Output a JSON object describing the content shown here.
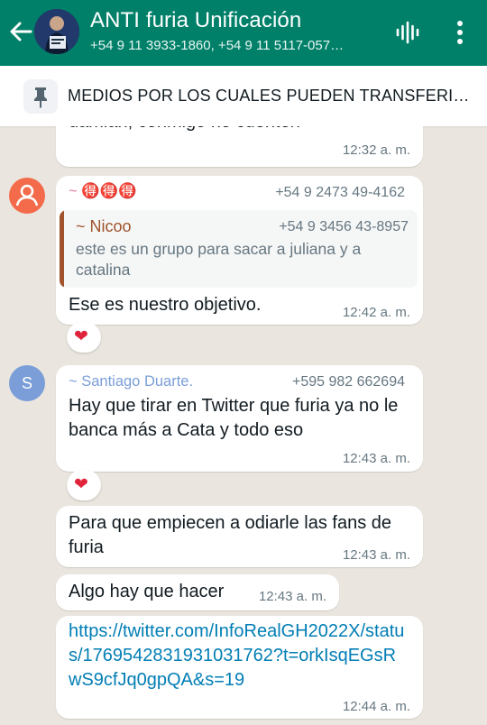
{
  "header": {
    "title": "ANTI furia Unificación",
    "subtitle": "+54 9 11 3933-1860, +54 9 11 5117-057…"
  },
  "pinned": {
    "text": "MEDIOS POR LOS CUALES PUEDEN TRANSFERIR…"
  },
  "messages": [
    {
      "text": "damián, conmigo no cuenten",
      "time": "12:32 a. m."
    },
    {
      "sender": "~ 🉐🉐🉐",
      "phone": "+54 9 2473 49-4162",
      "quote": {
        "sender": "~ Nicoo",
        "phone": "+54 9 3456 43-8957",
        "text": "este es un grupo para sacar a juliana y a catalina"
      },
      "text": "Ese es nuestro objetivo.",
      "time": "12:42 a. m.",
      "reaction": "❤"
    },
    {
      "avatar": "S",
      "sender": "~ Santiago Duarte.",
      "phone": "+595 982 662694",
      "text": "Hay que tirar en Twitter que furia ya no le banca más a Cata y todo eso",
      "time": "12:43 a. m.",
      "reaction": "❤"
    },
    {
      "text": "Para que empiecen a odiarle las fans de furia",
      "time": "12:43 a. m."
    },
    {
      "text": "Algo hay que hacer",
      "time": "12:43 a. m."
    },
    {
      "link": "https://twitter.com/InfoRealGH2022X/status/1769542831931031762?t=orkIsqEGsRwS9cfJq0gpQA&s=19",
      "time": "12:44 a. m."
    }
  ],
  "colors": {
    "header": "#008069",
    "chat_bg": "#eae6df",
    "link": "#027eb5",
    "sender_orange": "#e67e9a",
    "sender_blue": "#7b9ed8",
    "quote_sender": "#a0532d"
  }
}
